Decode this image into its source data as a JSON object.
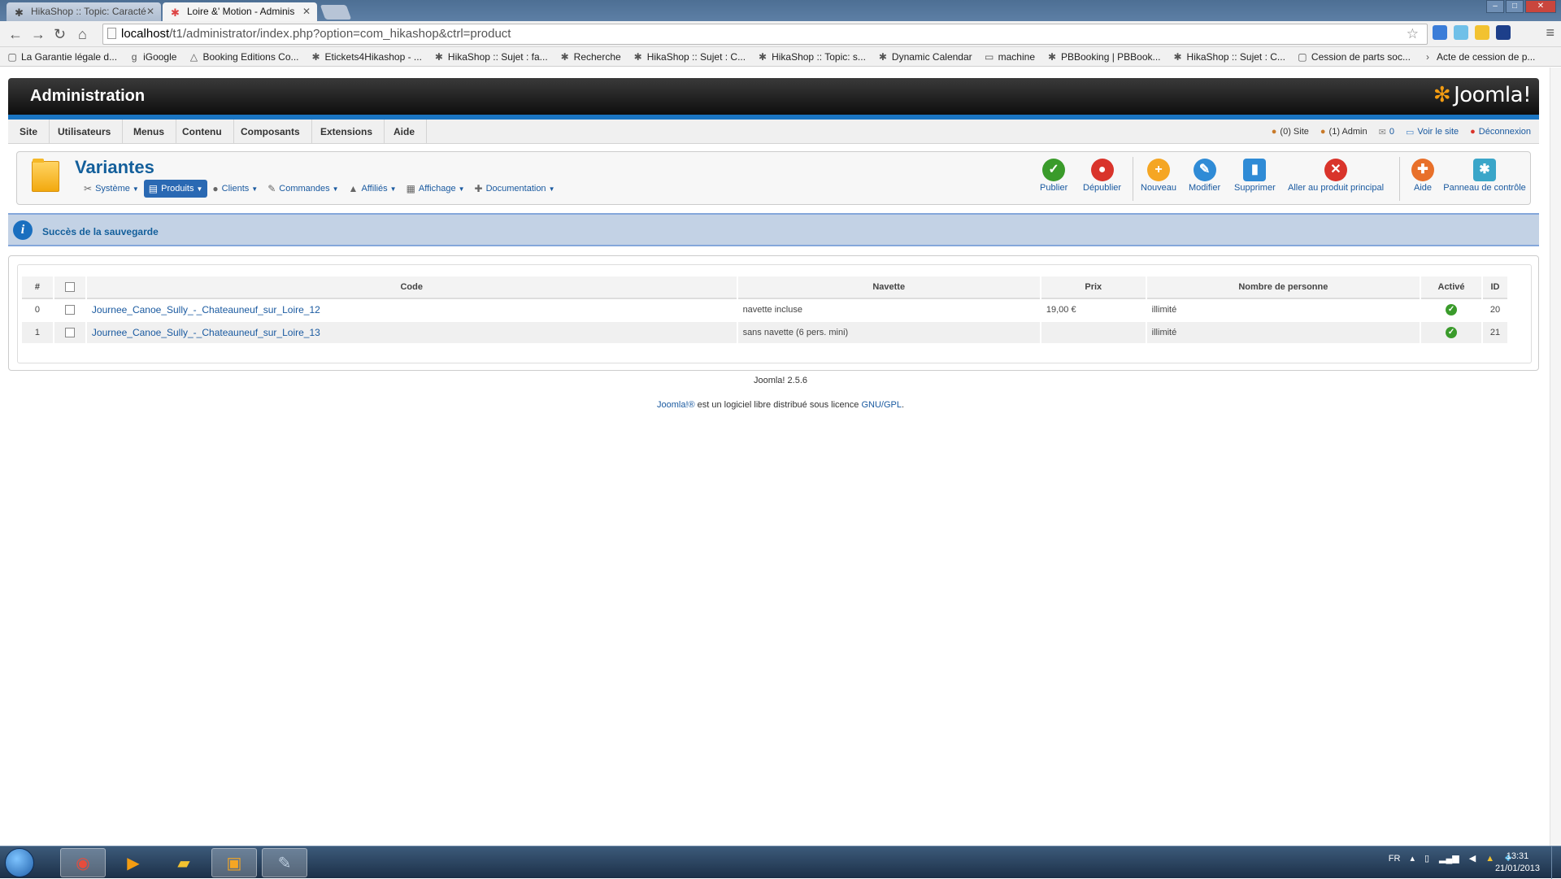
{
  "browser": {
    "tabs": [
      {
        "title": "HikaShop :: Topic: Caracté",
        "active": false
      },
      {
        "title": "Loire &' Motion - Adminis",
        "active": true
      }
    ],
    "url_host": "localhost",
    "url_path": "/t1/administrator/index.php?option=com_hikashop&ctrl=product",
    "bookmarks": [
      {
        "label": "La Garantie légale d...",
        "icon": "page-icon"
      },
      {
        "label": "iGoogle",
        "icon": "google-icon"
      },
      {
        "label": "Booking Editions Co...",
        "icon": "booking-icon"
      },
      {
        "label": "Etickets4Hikashop - ...",
        "icon": "joomla-icon"
      },
      {
        "label": "HikaShop :: Sujet : fa...",
        "icon": "hikashop-icon"
      },
      {
        "label": "Recherche",
        "icon": "hikashop-icon"
      },
      {
        "label": "HikaShop :: Sujet : C...",
        "icon": "hikashop-icon"
      },
      {
        "label": "HikaShop :: Topic: s...",
        "icon": "hikashop-icon"
      },
      {
        "label": "Dynamic Calendar",
        "icon": "hikashop-icon"
      },
      {
        "label": "machine",
        "icon": "folder-icon"
      },
      {
        "label": "PBBooking | PBBook...",
        "icon": "joomla-icon"
      },
      {
        "label": "HikaShop :: Sujet : C...",
        "icon": "hikashop-icon"
      },
      {
        "label": "Cession de parts soc...",
        "icon": "page-icon"
      },
      {
        "label": "Acte de cession de p...",
        "icon": "arrow-icon"
      }
    ]
  },
  "header": {
    "title": "Administration",
    "logo": "Joomla!"
  },
  "mainmenu": {
    "items": [
      "Site",
      "Utilisateurs",
      "Menus",
      "Contenu",
      "Composants",
      "Extensions",
      "Aide"
    ],
    "status": {
      "site": "(0) Site",
      "admin": "(1) Admin",
      "messages": "0",
      "view_site": "Voir le site",
      "logout": "Déconnexion"
    }
  },
  "page": {
    "title": "Variantes",
    "submenu": [
      {
        "label": "Système",
        "icon": "tools-icon",
        "active": false
      },
      {
        "label": "Produits",
        "icon": "box-icon",
        "active": true
      },
      {
        "label": "Clients",
        "icon": "users-icon",
        "active": false
      },
      {
        "label": "Commandes",
        "icon": "orders-icon",
        "active": false
      },
      {
        "label": "Affiliés",
        "icon": "affiliates-icon",
        "active": false
      },
      {
        "label": "Affichage",
        "icon": "display-icon",
        "active": false
      },
      {
        "label": "Documentation",
        "icon": "lifebuoy-icon",
        "active": false
      }
    ],
    "toolbar": {
      "publish": "Publier",
      "unpublish": "Dépublier",
      "new": "Nouveau",
      "edit": "Modifier",
      "delete": "Supprimer",
      "main_product": "Aller au produit principal",
      "help": "Aide",
      "control_panel": "Panneau de contrôle"
    },
    "colors": {
      "publish": "#3a9b2b",
      "unpublish": "#d9342b",
      "new": "#f5a623",
      "edit": "#2f8bd6",
      "delete": "#2f8bd6",
      "main_product": "#d9342b",
      "help": "#e8702a",
      "control_panel": "#3aa6c9"
    }
  },
  "message": "Succès de la sauvegarde",
  "table": {
    "headers": {
      "num": "#",
      "code": "Code",
      "navette": "Navette",
      "prix": "Prix",
      "personnes": "Nombre de personne",
      "active": "Activé",
      "id": "ID"
    },
    "rows": [
      {
        "num": "0",
        "code": "Journee_Canoe_Sully_-_Chateauneuf_sur_Loire_12",
        "navette": "navette incluse",
        "prix": "19,00 €",
        "personnes": "illimité",
        "active": true,
        "id": "20"
      },
      {
        "num": "1",
        "code": "Journee_Canoe_Sully_-_Chateauneuf_sur_Loire_13",
        "navette": "sans navette (6 pers. mini)",
        "prix": "",
        "personnes": "illimité",
        "active": true,
        "id": "21"
      }
    ]
  },
  "footer": {
    "version": "Joomla! 2.5.6",
    "license_link": "Joomla!®",
    "license_text": " est un logiciel libre distribué sous licence ",
    "gpl_link": "GNU/GPL",
    "period": "."
  },
  "taskbar": {
    "lang": "FR",
    "time": "13:31",
    "date": "21/01/2013"
  }
}
